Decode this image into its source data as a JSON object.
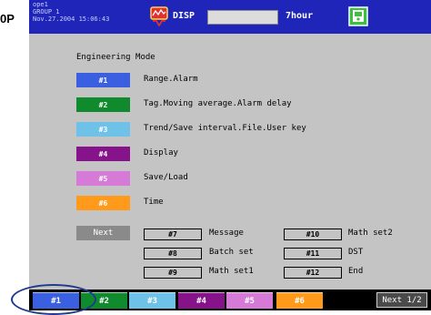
{
  "side_label": "0P",
  "status": {
    "user": "ope1",
    "group": "GROUP 1",
    "datetime": "Nov.27.2004 15:06:43",
    "mode_label": "DISP",
    "time_div": "7hour"
  },
  "title": "Engineering Mode",
  "menu_items": [
    {
      "key": "#1",
      "label": "Range.Alarm",
      "color": "#3a5fe0"
    },
    {
      "key": "#2",
      "label": "Tag.Moving average.Alarm delay",
      "color": "#0f8a2c"
    },
    {
      "key": "#3",
      "label": "Trend/Save interval.File.User key",
      "color": "#6ec2e8"
    },
    {
      "key": "#4",
      "label": "Display",
      "color": "#86138a"
    },
    {
      "key": "#5",
      "label": "Save/Load",
      "color": "#d57ad6"
    },
    {
      "key": "#6",
      "label": "Time",
      "color": "#ff9a1a"
    }
  ],
  "next_label": "Next",
  "sub_items": [
    {
      "key": "#7",
      "label": "Message"
    },
    {
      "key": "#8",
      "label": "Batch set"
    },
    {
      "key": "#9",
      "label": "Math set1"
    },
    {
      "key": "#10",
      "label": "Math set2"
    },
    {
      "key": "#11",
      "label": "DST"
    },
    {
      "key": "#12",
      "label": "End"
    }
  ],
  "softkeys": [
    {
      "label": "#1",
      "color": "#3a5fe0"
    },
    {
      "label": "#2",
      "color": "#0f8a2c"
    },
    {
      "label": "#3",
      "color": "#6ec2e8"
    },
    {
      "label": "#4",
      "color": "#86138a"
    },
    {
      "label": "#5",
      "color": "#d57ad6"
    },
    {
      "label": "#6",
      "color": "#ff9a1a"
    }
  ],
  "softkey_next": "Next 1/2",
  "icons": {
    "mode": "display-mode-icon",
    "media": "media-card-icon"
  }
}
